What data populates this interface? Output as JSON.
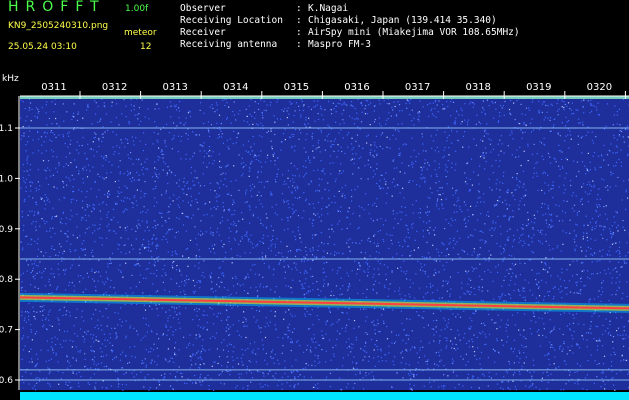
{
  "header": {
    "brand": "HROFFT",
    "version": "1.00f",
    "filename": "KN9_2505240310.png",
    "datetime": "25.05.24 03:10",
    "meteor_label": "meteor",
    "meteor_count": "12"
  },
  "info": [
    {
      "key": "Observer",
      "value": "K.Nagai"
    },
    {
      "key": "Receiving Location",
      "value": "Chigasaki, Japan (139.414 35.340)"
    },
    {
      "key": "Receiver",
      "value": "AirSpy mini (Miakejima VOR 108.65MHz)"
    },
    {
      "key": "Receiving antenna",
      "value": "Maspro FM-3"
    }
  ],
  "y_unit": "kHz",
  "chart_data": {
    "type": "heatmap",
    "title": "",
    "xlabel": "",
    "ylabel": "kHz",
    "x_ticks": [
      "0311",
      "0312",
      "0313",
      "0314",
      "0315",
      "0316",
      "0317",
      "0318",
      "0319",
      "0320"
    ],
    "y_ticks": [
      1.1,
      1.0,
      0.9,
      0.8,
      0.7,
      0.6
    ],
    "ylim": [
      0.58,
      1.2
    ],
    "lines_khz": [
      1.16,
      1.1,
      0.84,
      0.62,
      0.6
    ],
    "carrier": {
      "start_khz": 0.764,
      "end_khz": 0.742
    },
    "colors": {
      "background": "#1e2f9c",
      "noise": "#3f66ff",
      "line": "#9ed7ff",
      "carrier": "#ff4040",
      "carrier_edge": "#ffe800",
      "axis": "#ffffff",
      "bottom_bar": "#00e5ff"
    }
  }
}
